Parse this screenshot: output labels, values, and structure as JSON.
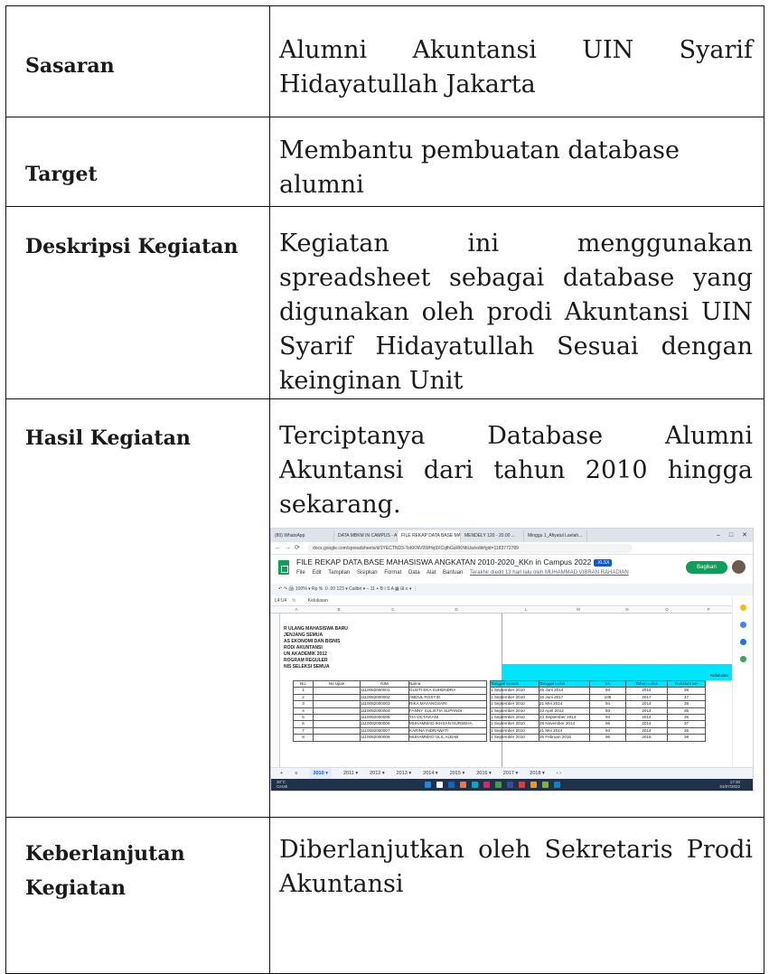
{
  "rows": [
    {
      "label": "Sasaran",
      "value": "Alumni Akuntansi UIN Syarif Hidayatullah Jakarta"
    },
    {
      "label": "Target",
      "value": "Membantu pembuatan database alumni"
    },
    {
      "label": "Deskripsi Kegiatan",
      "value": "Kegiatan ini menggunakan spreadsheet sebagai database yang digunakan oleh prodi Akuntansi UIN Syarif Hidayatullah Sesuai dengan keinginan Unit"
    },
    {
      "label": "Hasil Kegiatan",
      "value": "Terciptanya Database Alumni Akuntansi dari tahun 2010 hingga sekarang."
    },
    {
      "label": "Keberlanjutan Kegiatan",
      "value": "Diberlanjutkan oleh Sekretaris Prodi Akuntansi"
    }
  ],
  "screenshot": {
    "tabs": [
      "(80) WhatsApp",
      "DATA MBKM IN CAMPUS - AKUN...",
      "FILE REKAP DATA BASE MAHA...",
      "MENDELY 120 - 20.00 ...",
      "Minggu 1_Afiyatul Laelah..."
    ],
    "url": "docs.google.com/spreadsheets/d/1YECTND3-ToKKNV0WHq9XCqfhGsRKNtiUw/edit#gid=1183772789",
    "title": "FILE REKAP DATA BASE MAHASISWA ANGKATAN 2010-2020_KKn in Campus 2022",
    "badge": ".XLSX",
    "menus": [
      "File",
      "Edit",
      "Tampilan",
      "Sisipkan",
      "Format",
      "Data",
      "Alat",
      "Bantuan"
    ],
    "edit_note": "Terakhir diedit 13 hari lalu oleh MUHAMMAD VIBRAN RAHADIAN",
    "share": "Bagikan",
    "toolbar": "↶  ↷  🖨  100% ▾   Rp  %  .0  .00  123 ▾   Calibri ▾   –  11  +   B  I  S  A   ▦  ⊞   ≡ ▾   ⋮",
    "cell_ref": "L4:U4",
    "fx": "fx",
    "formula": "Kelulusan",
    "columns": [
      "A",
      "B",
      "C",
      "D",
      "L",
      "M",
      "N",
      "O",
      "P"
    ],
    "header_block": "R ULANG MAHASISWA BARU\nJENJANG SEMUA\nAS EKONOMI DAN BISNIS\nRODI AKUNTANSI\nUN AKADEMIK 2012\nROGRAM REGULER\nNIS SELEKSI SEMUA",
    "kelulusan": "Kelulusan",
    "table_head": [
      "No.",
      "No Ujian",
      "NIM",
      "Nama",
      "Tanggal Masuk",
      "Tanggal Lulus",
      "SK",
      "Tahun Lulus",
      "Yudisium ke-"
    ],
    "table_rows": [
      [
        "1",
        "",
        "1110082000001",
        "GUSTI EKA SUHENDRA",
        "1 September 2010",
        "25 Juni 2014",
        "94",
        "2014",
        "36"
      ],
      [
        "2",
        "",
        "1110082000002",
        "ABDUL ROSYID",
        "1 September 2010",
        "16 Juni 2017",
        "105",
        "2017",
        "47"
      ],
      [
        "3",
        "",
        "1110082000003",
        "RIKA MAYANGSARI",
        "1 September 2010",
        "21 Mei 2014",
        "94",
        "2014",
        "36"
      ],
      [
        "4",
        "",
        "1110082000004",
        "FANNY SULISTIA SUPANDI",
        "1 September 2010",
        "23 April 2014",
        "93",
        "2014",
        "35"
      ],
      [
        "5",
        "",
        "1110082000005",
        "TIA OCTAVIANI",
        "1 September 2010",
        "23 September 2014",
        "94",
        "2014",
        "36"
      ],
      [
        "6",
        "",
        "1110082000006",
        "MUHAMMAD IKHSAN NURSEHA",
        "1 September 2010",
        "28 November 2014",
        "95",
        "2014",
        "37"
      ],
      [
        "7",
        "",
        "1110082000007",
        "KARINA INDRAWATI",
        "1 September 2010",
        "21 Mei 2014",
        "94",
        "2014",
        "36"
      ],
      [
        "8",
        "",
        "1110082000008",
        "MUHAMMAD ULIL ALBAB",
        "1 September 2010",
        "25 Februari 2015",
        "96",
        "2015",
        "38"
      ]
    ],
    "sheet_tabs": [
      "+",
      "≡",
      "2010 ▾",
      "2011 ▾",
      "2012 ▾",
      "2013 ▾",
      "2014 ▾",
      "2015 ▾",
      "2016 ▾",
      "2017 ▾",
      "2018 ▾",
      "‹  ›"
    ],
    "weather": "30°C\nCerah",
    "clock": "17:30\n01/07/2022",
    "taskbar_colors": [
      "#1e88e5",
      "#ffffff",
      "#1565c0",
      "#ff7043",
      "#00acc1",
      "#e91e63",
      "#43a047",
      "#3949ab",
      "#e53935",
      "#ff9800",
      "#7cb342",
      "#0288d1"
    ],
    "sidebar_colors": [
      "#fbbc04",
      "#4285f4",
      "#1a73e8",
      "#34a853"
    ],
    "colors": {
      "accent": "#0f9d58",
      "highlight": "#00e5ff"
    }
  }
}
